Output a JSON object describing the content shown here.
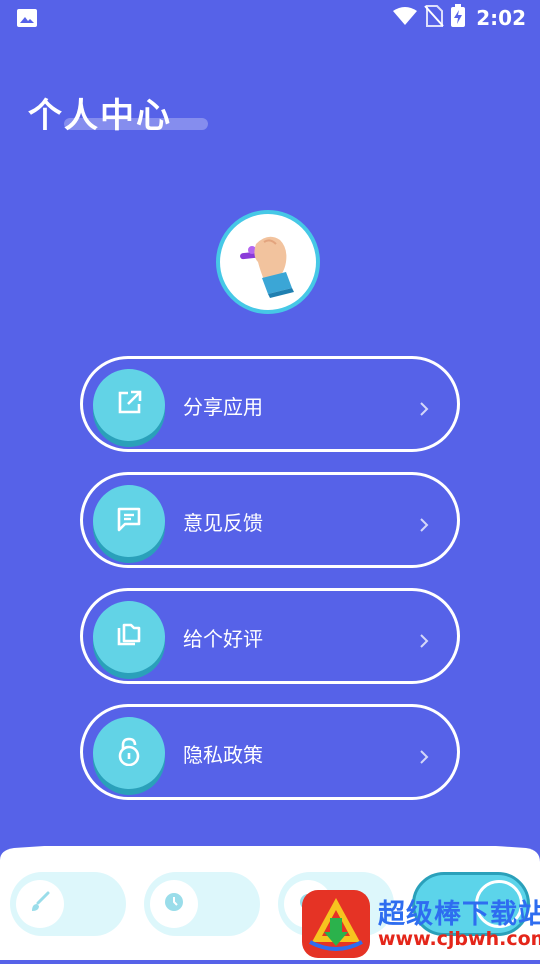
{
  "status_bar": {
    "time": "2:02"
  },
  "header": {
    "title": "个人中心"
  },
  "menu": [
    {
      "label": "分享应用",
      "icon": "share-icon"
    },
    {
      "label": "意见反馈",
      "icon": "feedback-icon"
    },
    {
      "label": "给个好评",
      "icon": "rate-icon"
    },
    {
      "label": "隐私政策",
      "icon": "privacy-lock-icon"
    }
  ],
  "bottom_nav": [
    {
      "icon": "brush-icon"
    },
    {
      "icon": "clock-icon"
    },
    {
      "icon": "tab-3-icon"
    },
    {
      "icon": "profile-icon",
      "active": true
    }
  ],
  "watermark": {
    "title": "超级棒下载站",
    "url": "www.cjbwh.com"
  },
  "colors": {
    "background": "#5662E8",
    "accent": "#62D3E6",
    "nav_pill": "#DDF7FB"
  }
}
